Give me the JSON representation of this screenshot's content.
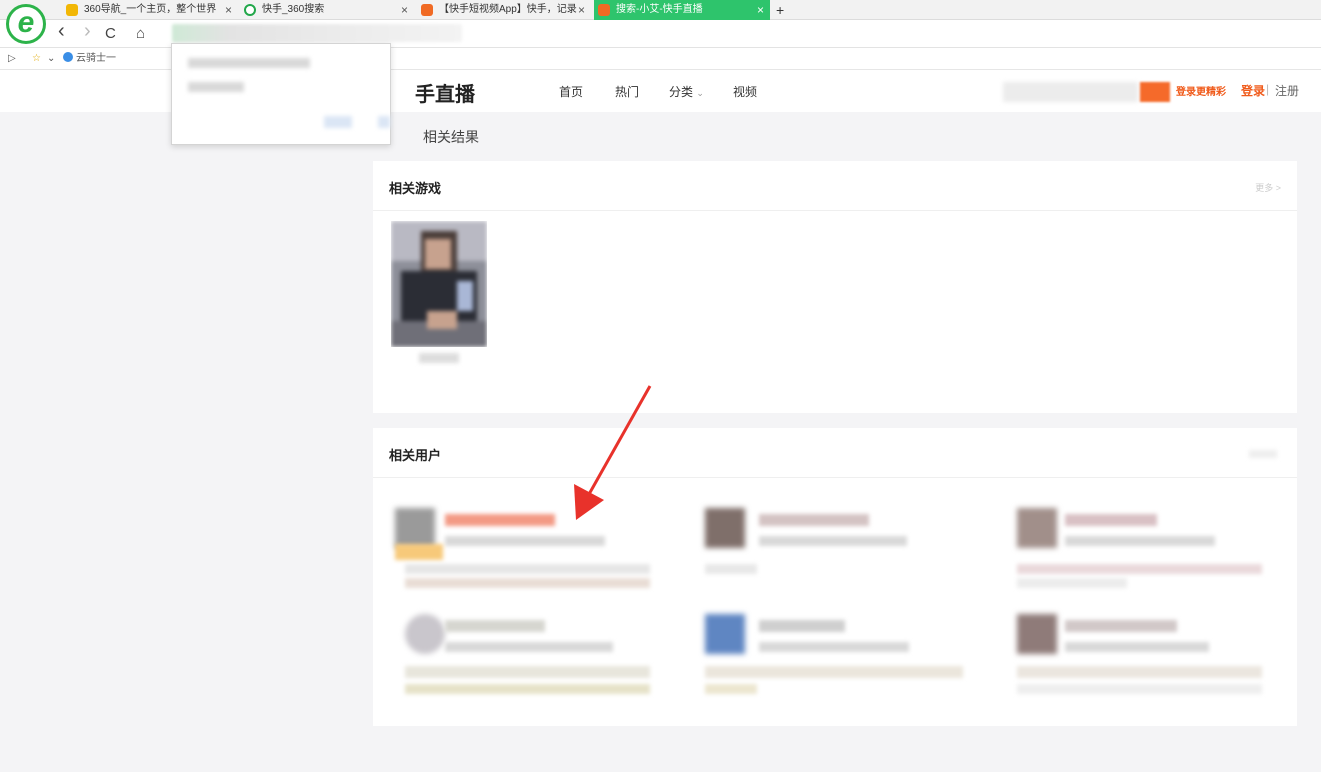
{
  "browser": {
    "tabs": [
      {
        "title": "360导航_一个主页，整个世界",
        "fav_color": "#f2b705",
        "active": false
      },
      {
        "title": "快手_360搜索",
        "fav_color": "#22a74a",
        "active": false
      },
      {
        "title": "【快手短视频App】快手，记录",
        "fav_color": "#f06a24",
        "active": false
      },
      {
        "title": "搜索-小艾-快手直播",
        "fav_color": "#f06a24",
        "active": true
      }
    ],
    "tab_close": "×",
    "tab_add": "+",
    "nav": {
      "back": "‹",
      "forward": "›",
      "refresh": "C",
      "home": "⌂"
    },
    "bookmarks": {
      "toggle": "▷",
      "fav_icon": "☆",
      "fav_menu": "⌄",
      "item": "云骑士一"
    },
    "logo_letter": "e"
  },
  "site": {
    "title": "手直播",
    "nav": [
      "首页",
      "热门",
      "分类",
      "视频"
    ],
    "category_caret": "⌄",
    "promo": "登录更精彩",
    "login": "登录",
    "separator": "|",
    "register": "注册"
  },
  "results_label": "相关结果",
  "sections": {
    "games": {
      "title": "相关游戏",
      "more": "更多 >"
    },
    "users": {
      "title": "相关用户"
    }
  },
  "colors": {
    "brand_orange": "#f05a1a",
    "active_tab": "#2ec46c",
    "arrow": "#e8322b"
  }
}
